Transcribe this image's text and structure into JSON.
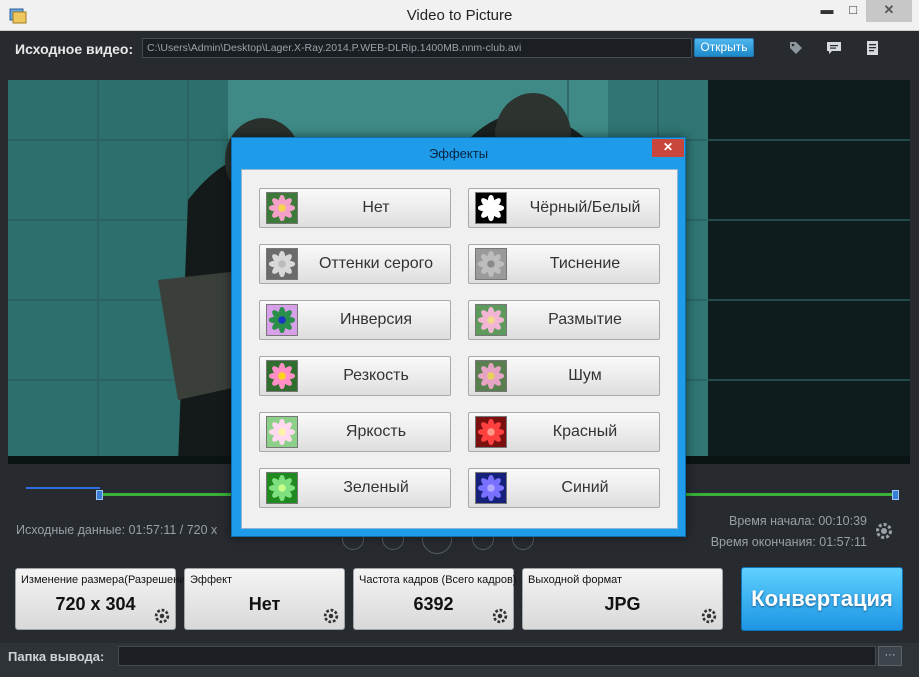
{
  "window": {
    "title": "Video to Picture",
    "minimize_glyph": "▬",
    "maximize_glyph": "□",
    "close_glyph": "✕"
  },
  "source": {
    "label": "Исходное видео:",
    "path": "C:\\Users\\Admin\\Desktop\\Lager.X-Ray.2014.P.WEB-DLRip.1400MB.nnm-club.avi",
    "open_label": "Открыть"
  },
  "info": {
    "source_data": "Исходные данные: 01:57:11 / 720 x",
    "start_time": "Время начала: 00:10:39",
    "end_time": "Время окончания: 01:57:11"
  },
  "settings": {
    "resize": {
      "label": "Изменение размера(Разрешение)",
      "value": "720 x 304"
    },
    "effect": {
      "label": "Эффект",
      "value": "Нет"
    },
    "fps": {
      "label": "Частота кадров (Всего кадров)",
      "value": "6392"
    },
    "format": {
      "label": "Выходной формат",
      "value": "JPG"
    }
  },
  "convert_label": "Конвертация",
  "output": {
    "label": "Папка вывода:",
    "browse_label": "···"
  },
  "dialog": {
    "title": "Эффекты",
    "close_glyph": "✕",
    "effects": [
      {
        "label": "Нет",
        "thumb": "flower-normal"
      },
      {
        "label": "Чёрный/Белый",
        "thumb": "flower-bw"
      },
      {
        "label": "Оттенки серого",
        "thumb": "flower-gray"
      },
      {
        "label": "Тиснение",
        "thumb": "flower-emboss"
      },
      {
        "label": "Инверсия",
        "thumb": "flower-invert"
      },
      {
        "label": "Размытие",
        "thumb": "flower-blur"
      },
      {
        "label": "Резкость",
        "thumb": "flower-sharpen"
      },
      {
        "label": "Шум",
        "thumb": "flower-noise"
      },
      {
        "label": "Яркость",
        "thumb": "flower-bright"
      },
      {
        "label": "Красный",
        "thumb": "flower-red"
      },
      {
        "label": "Зеленый",
        "thumb": "flower-green"
      },
      {
        "label": "Синий",
        "thumb": "flower-blue"
      }
    ]
  },
  "colors": {
    "accent": "#1e9be9",
    "timeline_played": "#2e6fe0",
    "timeline_range": "#38b03a"
  }
}
